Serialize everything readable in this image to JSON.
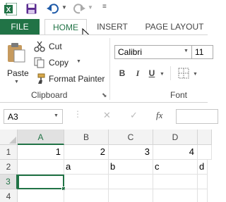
{
  "tabs": {
    "file": "FILE",
    "home": "HOME",
    "insert": "INSERT",
    "page_layout": "PAGE LAYOUT"
  },
  "clipboard": {
    "paste": "Paste",
    "cut": "Cut",
    "copy": "Copy",
    "format_painter": "Format Painter",
    "group_label": "Clipboard"
  },
  "font": {
    "name": "Calibri",
    "size": "11",
    "group_label": "Font",
    "bold": "B",
    "italic": "I",
    "underline": "U"
  },
  "formula_bar": {
    "name_box": "A3",
    "fx": "fx"
  },
  "grid": {
    "columns": [
      "A",
      "B",
      "C",
      "D"
    ],
    "rows": [
      "1",
      "2",
      "3",
      "4"
    ],
    "row1": [
      "1",
      "2",
      "3",
      "4"
    ],
    "row2": [
      "a",
      "b",
      "c",
      "d"
    ]
  },
  "colors": {
    "accent": "#217346"
  }
}
